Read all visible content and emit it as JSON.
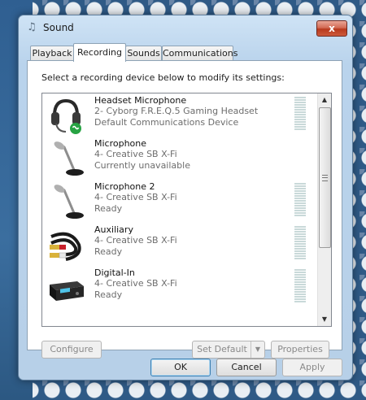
{
  "window": {
    "title": "Sound",
    "close_glyph": "x"
  },
  "tabs": [
    {
      "label": "Playback",
      "active": false
    },
    {
      "label": "Recording",
      "active": true
    },
    {
      "label": "Sounds",
      "active": false
    },
    {
      "label": "Communications",
      "active": false
    }
  ],
  "recording": {
    "instruction": "Select a recording device below to modify its settings:",
    "devices": [
      {
        "name": "Headset Microphone",
        "description": "2- Cyborg F.R.E.Q.5 Gaming Headset",
        "status": "Default Communications Device",
        "icon": "headset-icon"
      },
      {
        "name": "Microphone",
        "description": "4- Creative SB X-Fi",
        "status": "Currently unavailable",
        "icon": "microphone-icon"
      },
      {
        "name": "Microphone 2",
        "description": "4- Creative SB X-Fi",
        "status": "Ready",
        "icon": "microphone-icon"
      },
      {
        "name": "Auxiliary",
        "description": "4- Creative SB X-Fi",
        "status": "Ready",
        "icon": "rca-cable-icon"
      },
      {
        "name": "Digital-In",
        "description": "4- Creative SB X-Fi",
        "status": "Ready",
        "icon": "digital-receiver-icon"
      }
    ]
  },
  "panel_buttons": {
    "configure": "Configure",
    "set_default": "Set Default",
    "properties": "Properties"
  },
  "dialog_buttons": {
    "ok": "OK",
    "cancel": "Cancel",
    "apply": "Apply"
  },
  "colors": {
    "accent": "#3c7fb1",
    "close_button": "#c9452b"
  }
}
